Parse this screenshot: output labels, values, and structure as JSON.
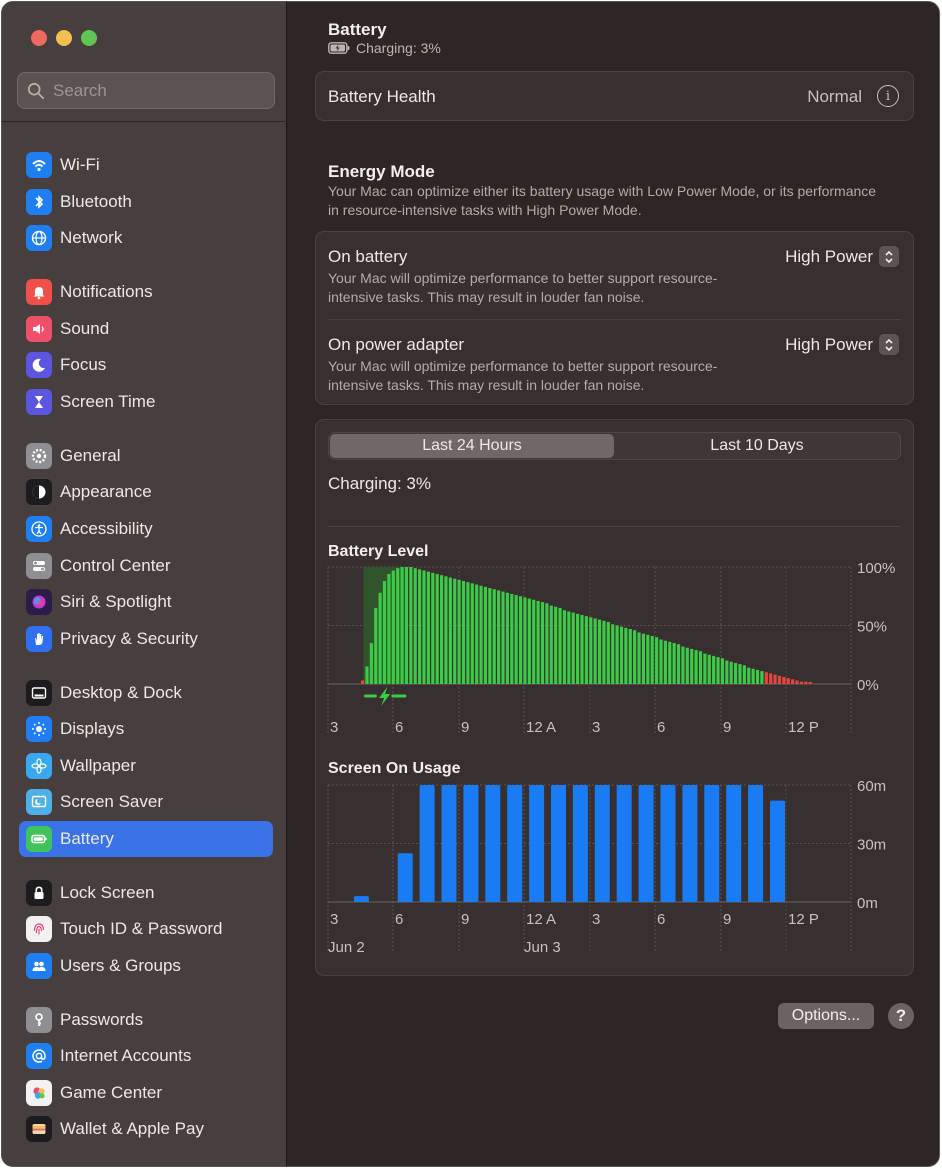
{
  "window": {
    "title": "Battery",
    "subtitle": "Charging: 3%"
  },
  "search": {
    "placeholder": "Search"
  },
  "sidebar": {
    "items": [
      {
        "label": "Wi-Fi",
        "icon": "wifi-icon",
        "color": "#1f7ff2"
      },
      {
        "label": "Bluetooth",
        "icon": "bluetooth-icon",
        "color": "#1f7ff2"
      },
      {
        "label": "Network",
        "icon": "globe-icon",
        "color": "#1f7ff2"
      },
      {
        "label": "Notifications",
        "icon": "bell-icon",
        "color": "#f04f4a"
      },
      {
        "label": "Sound",
        "icon": "speaker-icon",
        "color": "#f04f6a"
      },
      {
        "label": "Focus",
        "icon": "moon-icon",
        "color": "#5b55e0"
      },
      {
        "label": "Screen Time",
        "icon": "hourglass-icon",
        "color": "#5b55e0"
      },
      {
        "label": "General",
        "icon": "gear-icon",
        "color": "#8e8e93"
      },
      {
        "label": "Appearance",
        "icon": "appearance-icon",
        "color": "#1c1c1e"
      },
      {
        "label": "Accessibility",
        "icon": "accessibility-icon",
        "color": "#1f7ff2"
      },
      {
        "label": "Control Center",
        "icon": "toggles-icon",
        "color": "#8e8e93"
      },
      {
        "label": "Siri & Spotlight",
        "icon": "siri-icon",
        "color": "#2b1d4a"
      },
      {
        "label": "Privacy & Security",
        "icon": "hand-icon",
        "color": "#2f6ff0"
      },
      {
        "label": "Desktop & Dock",
        "icon": "dock-icon",
        "color": "#1c1c1e"
      },
      {
        "label": "Displays",
        "icon": "sun-icon",
        "color": "#1f7ff2"
      },
      {
        "label": "Wallpaper",
        "icon": "flower-icon",
        "color": "#3aa8f0"
      },
      {
        "label": "Screen Saver",
        "icon": "screensaver-icon",
        "color": "#4fb0e8"
      },
      {
        "label": "Battery",
        "icon": "battery-icon",
        "color": "#3fc35a"
      },
      {
        "label": "Lock Screen",
        "icon": "lock-icon",
        "color": "#1c1c1e"
      },
      {
        "label": "Touch ID & Password",
        "icon": "fingerprint-icon",
        "color": "#f2f2f2"
      },
      {
        "label": "Users & Groups",
        "icon": "users-icon",
        "color": "#1f7ff2"
      },
      {
        "label": "Passwords",
        "icon": "key-icon",
        "color": "#8e8e93"
      },
      {
        "label": "Internet Accounts",
        "icon": "at-icon",
        "color": "#1f7ff2"
      },
      {
        "label": "Game Center",
        "icon": "game-center-icon",
        "color": "#f2f2f2"
      },
      {
        "label": "Wallet & Apple Pay",
        "icon": "wallet-icon",
        "color": "#1c1c1e"
      }
    ],
    "selected": "Battery"
  },
  "battery_health": {
    "label": "Battery Health",
    "value": "Normal"
  },
  "energy_mode": {
    "title": "Energy Mode",
    "description": "Your Mac can optimize either its battery usage with Low Power Mode, or its performance in resource-intensive tasks with High Power Mode.",
    "on_battery": {
      "label": "On battery",
      "value": "High Power",
      "description": "Your Mac will optimize performance to better support resource-intensive tasks. This may result in louder fan noise."
    },
    "on_power_adapter": {
      "label": "On power adapter",
      "value": "High Power",
      "description": "Your Mac will optimize performance to better support resource-intensive tasks. This may result in louder fan noise."
    }
  },
  "usage": {
    "tabs": [
      "Last 24 Hours",
      "Last 10 Days"
    ],
    "active_tab": "Last 24 Hours",
    "status": "Charging: 3%"
  },
  "chart_data": [
    {
      "type": "bar",
      "title": "Battery Level",
      "x_ticks": [
        "3",
        "6",
        "9",
        "12 A",
        "3",
        "6",
        "9",
        "12 P"
      ],
      "y_ticks": [
        "100%",
        "50%",
        "0%"
      ],
      "ylim": [
        0,
        100
      ],
      "charging_period": {
        "start_bar": 1,
        "end_bar": 10
      },
      "low_battery_threshold": 10,
      "colors": {
        "normal": "#3ccb47",
        "low": "#e8453c",
        "charging_bg": "#2f5a2c"
      },
      "values": [
        3,
        15,
        35,
        65,
        78,
        88,
        94,
        97,
        99,
        100,
        100,
        100,
        99,
        98,
        97,
        96,
        95,
        94,
        93,
        92,
        91,
        90,
        89,
        88,
        87,
        86,
        85,
        84,
        83,
        82,
        81,
        80,
        79,
        78,
        77,
        76,
        75,
        74,
        73,
        72,
        71,
        70,
        69,
        67,
        66,
        65,
        63,
        62,
        61,
        60,
        59,
        58,
        57,
        56,
        55,
        54,
        53,
        51,
        50,
        49,
        48,
        47,
        46,
        44,
        43,
        42,
        41,
        40,
        38,
        37,
        36,
        35,
        34,
        32,
        31,
        30,
        29,
        28,
        26,
        25,
        24,
        23,
        22,
        20,
        19,
        18,
        17,
        16,
        14,
        13,
        12,
        11,
        10,
        9,
        8,
        7,
        6,
        5,
        4,
        3,
        2,
        2,
        1
      ]
    },
    {
      "type": "bar",
      "title": "Screen On Usage",
      "x_ticks": [
        "3",
        "6",
        "9",
        "12 A",
        "3",
        "6",
        "9",
        "12 P"
      ],
      "x_date_labels": [
        {
          "label": "Jun 2",
          "at_tick": 0
        },
        {
          "label": "Jun 3",
          "at_tick": 3
        }
      ],
      "y_ticks": [
        "60m",
        "30m",
        "0m"
      ],
      "ylim": [
        0,
        60
      ],
      "color": "#1a7cf5",
      "values": [
        0,
        3,
        0,
        25,
        60,
        60,
        60,
        60,
        60,
        60,
        60,
        60,
        60,
        60,
        60,
        60,
        60,
        60,
        60,
        60,
        52
      ]
    }
  ],
  "footer": {
    "options_label": "Options...",
    "help_label": "?"
  }
}
